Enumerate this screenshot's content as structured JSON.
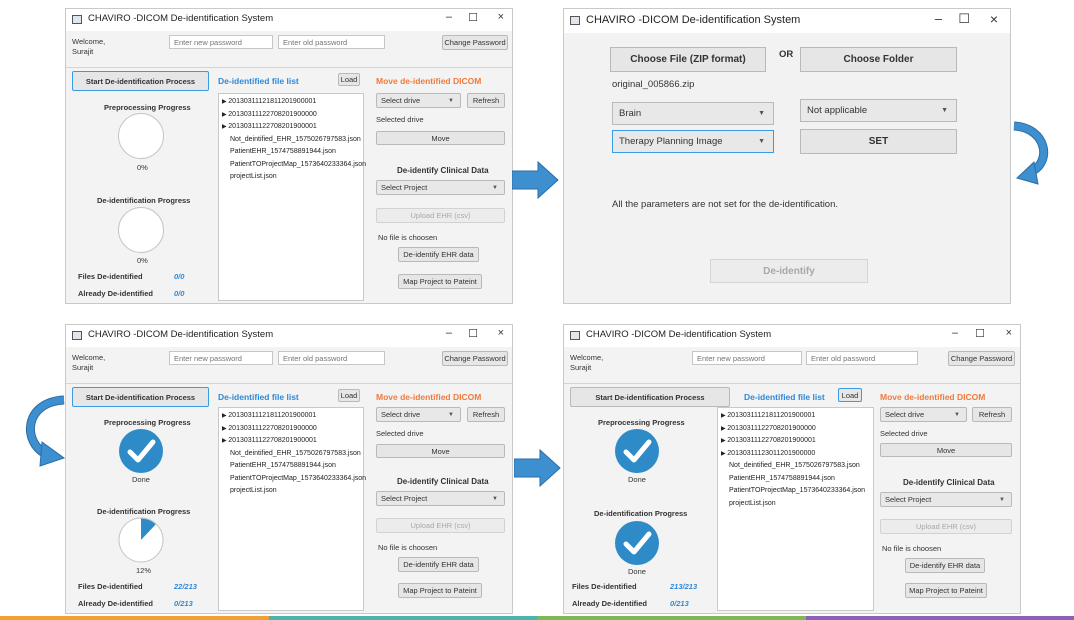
{
  "app": {
    "title": "CHAVIRO -DICOM De-identification System",
    "controls": {
      "minimize": "–",
      "maximize": "☐",
      "close": "×"
    }
  },
  "auth": {
    "welcome_line1": "Welcome,",
    "welcome_line2": "Surajit",
    "new_password_placeholder": "Enter new password",
    "old_password_placeholder": "Enter old password",
    "change_password_label": "Change Password"
  },
  "panel": {
    "start_button": "Start De-identification Process",
    "preprocessing_label": "Preprocessing Progress",
    "deid_label": "De-identification Progress",
    "files_deidentified_label": "Files De-identified",
    "already_deidentified_label": "Already De-identified",
    "file_list_title": "De-identified file list",
    "load_button": "Load",
    "move_title": "Move de-identified DICOM",
    "select_drive": "Select drive",
    "refresh_button": "Refresh",
    "selected_drive_label": "Selected drive",
    "move_button": "Move",
    "clinical_title": "De-identify Clinical Data",
    "select_project": "Select Project",
    "upload_ehr_button": "Upload EHR (csv)",
    "no_file_label": "No file is choosen",
    "deidentify_ehr_button": "De-identify EHR data",
    "map_project_button": "Map Project to Pateint"
  },
  "files_3": [
    {
      "name": "20130311121811201900001",
      "folder": true
    },
    {
      "name": "20130311122708201900000",
      "folder": true
    },
    {
      "name": "20130311122708201900001",
      "folder": true
    },
    {
      "name": "Not_deintified_EHR_1575026797583.json",
      "folder": false
    },
    {
      "name": "PatientEHR_1574758891944.json",
      "folder": false
    },
    {
      "name": "PatientTOProjectMap_1573640233364.json",
      "folder": false
    },
    {
      "name": "projectList.json",
      "folder": false
    }
  ],
  "files_4": [
    {
      "name": "20130311121811201900001",
      "folder": true
    },
    {
      "name": "20130311122708201900000",
      "folder": true
    },
    {
      "name": "20130311122708201900001",
      "folder": true
    },
    {
      "name": "20130311123011201900000",
      "folder": true
    },
    {
      "name": "Not_deintified_EHR_1575026797583.json",
      "folder": false
    },
    {
      "name": "PatientEHR_1574758891944.json",
      "folder": false
    },
    {
      "name": "PatientTOProjectMap_1573640233364.json",
      "folder": false
    },
    {
      "name": "projectList.json",
      "folder": false
    }
  ],
  "states": {
    "initial": {
      "preprocessing_text": "0%",
      "deid_text": "0%",
      "files_count": "0/0",
      "already_count": "0/0"
    },
    "in_progress": {
      "preprocessing_text": "Done",
      "deid_text": "12%",
      "deid_fraction": 0.12,
      "files_count": "22/213",
      "already_count": "0/213"
    },
    "complete": {
      "preprocessing_text": "Done",
      "deid_text": "Done",
      "files_count": "213/213",
      "already_count": "0/213"
    }
  },
  "dialog": {
    "choose_file_button": "Choose File (ZIP format)",
    "or_label": "OR",
    "choose_folder_button": "Choose Folder",
    "file_name": "original_005866.zip",
    "body_part": "Brain",
    "not_applicable": "Not applicable",
    "image_type": "Therapy Planning Image",
    "set_button": "SET",
    "status_message": "All the parameters are not set for the de-identification.",
    "deidentify_button": "De-identify"
  },
  "colors": {
    "accent_blue": "#2f88d8",
    "accent_orange": "#f07a3c",
    "check_blue": "#2f8bc7",
    "arrow_blue": "#3d8fd0"
  }
}
